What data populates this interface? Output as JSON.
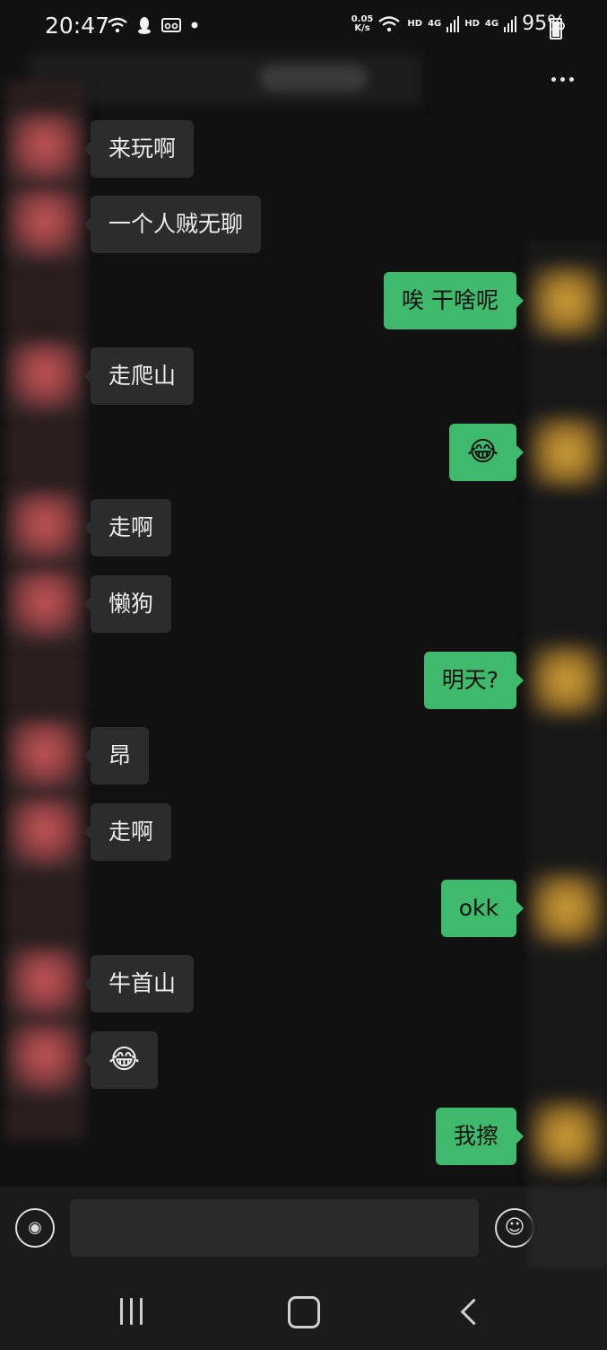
{
  "status_bar": {
    "time": "20:47",
    "net_speed_value": "0.05",
    "net_speed_unit": "K/s",
    "sim1_label": "HD",
    "sim1_net": "4G",
    "sim2_label": "HD",
    "sim2_net": "4G",
    "battery": "95%"
  },
  "messages": [
    {
      "side": "in",
      "text": "来玩啊"
    },
    {
      "side": "in",
      "text": "一个人贼无聊"
    },
    {
      "side": "out",
      "text": "唉 干啥呢"
    },
    {
      "side": "in",
      "text": "走爬山"
    },
    {
      "side": "out",
      "text": "😂"
    },
    {
      "side": "in",
      "text": "走啊"
    },
    {
      "side": "in",
      "text": "懒狗"
    },
    {
      "side": "out",
      "text": "明天?"
    },
    {
      "side": "in",
      "text": "昂"
    },
    {
      "side": "in",
      "text": "走啊"
    },
    {
      "side": "out",
      "text": "okk"
    },
    {
      "side": "in",
      "text": "牛首山"
    },
    {
      "side": "in",
      "text": "😂"
    },
    {
      "side": "out",
      "text": "我擦"
    }
  ],
  "input": {
    "value": ""
  },
  "icons": {
    "more": "more-dots-icon",
    "voice": "voice-icon",
    "emoji": "emoji-icon",
    "nav_recent": "recent-apps-icon",
    "nav_home": "home-icon",
    "nav_back": "back-icon"
  },
  "colors": {
    "background": "#111111",
    "incoming_bubble": "#2c2c2c",
    "outgoing_bubble": "#3fba6d"
  }
}
